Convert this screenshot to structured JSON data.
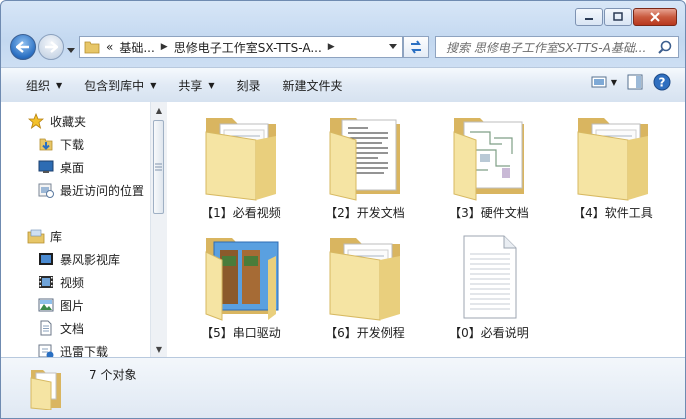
{
  "window": {
    "address_segments": [
      "«",
      "基础...",
      "思修电子工作室SX-TTS-A..."
    ],
    "search_placeholder": "搜索 思修电子工作室SX-TTS-A基础..."
  },
  "toolbar": {
    "items": [
      {
        "label": "组织",
        "dropdown": true
      },
      {
        "label": "包含到库中",
        "dropdown": true
      },
      {
        "label": "共享",
        "dropdown": true
      },
      {
        "label": "刻录",
        "dropdown": false
      },
      {
        "label": "新建文件夹",
        "dropdown": false
      }
    ]
  },
  "navpane": {
    "favorites": {
      "label": "收藏夹",
      "items": [
        "下载",
        "桌面",
        "最近访问的位置"
      ]
    },
    "libraries": {
      "label": "库",
      "items": [
        "暴风影视库",
        "视频",
        "图片",
        "文档",
        "迅雷下载"
      ]
    }
  },
  "files": [
    {
      "label": "【1】必看视频",
      "kind": "folder-docs"
    },
    {
      "label": "【2】开发文档",
      "kind": "folder-paper"
    },
    {
      "label": "【3】硬件文档",
      "kind": "folder-schematic"
    },
    {
      "label": "【4】软件工具",
      "kind": "folder-docs"
    },
    {
      "label": "【5】串口驱动",
      "kind": "folder-app"
    },
    {
      "label": "【6】开发例程",
      "kind": "folder-docs"
    },
    {
      "label": "【0】必看说明",
      "kind": "text-file"
    }
  ],
  "details": {
    "count_text": "7 个对象"
  },
  "colors": {
    "folder_light": "#f7e6a6",
    "folder_dark": "#d9b560",
    "selection_blue": "#2a6fc2"
  }
}
